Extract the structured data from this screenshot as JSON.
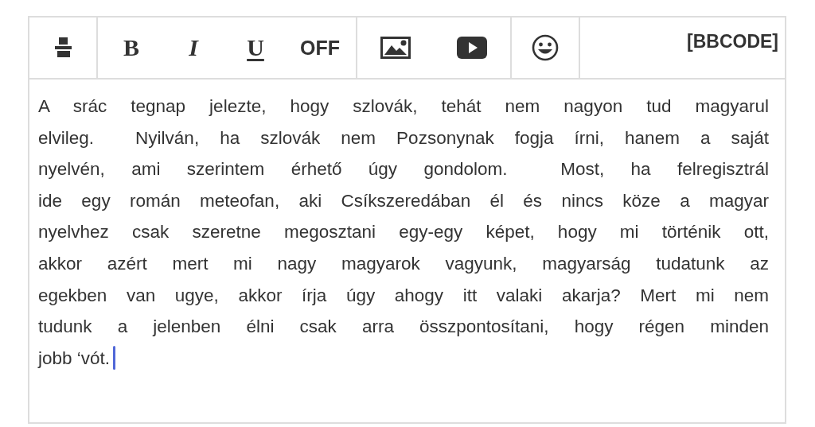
{
  "toolbar": {
    "groups": [
      [
        {
          "kind": "clear-format"
        }
      ],
      [
        {
          "kind": "bold",
          "label": "B"
        },
        {
          "kind": "italic",
          "label": "I"
        },
        {
          "kind": "underline",
          "label": "U"
        },
        {
          "kind": "text",
          "label": "OFF"
        }
      ],
      [
        {
          "kind": "image"
        },
        {
          "kind": "video"
        }
      ],
      [
        {
          "kind": "emoji"
        }
      ]
    ],
    "mode_button": "[BBCODE]"
  },
  "editor": {
    "lines": [
      "A srác tegnap jelezte, hogy szlovák, tehát nem nagyon tud magyarul",
      "elvileg.  Nyilván, ha szlovák nem Pozsonynak fogja írni, hanem a saját",
      "nyelvén, ami szerintem érhető úgy gondolom.  Most, ha felregisztrál",
      "ide egy román meteofan, aki Csíkszeredában él és nincs köze a magyar",
      "nyelvhez csak szeretne megosztani egy-egy képet, hogy mi történik ott,",
      "akkor azért mert mi nagy magyarok vagyunk, magyarság tudatunk az",
      "egekben van ugye, akkor írja úgy ahogy itt valaki akarja? Mert mi nem",
      "tudunk a jelenben élni csak arra összpontosítani, hogy régen minden",
      "jobb ‘vót."
    ],
    "focused": true
  }
}
